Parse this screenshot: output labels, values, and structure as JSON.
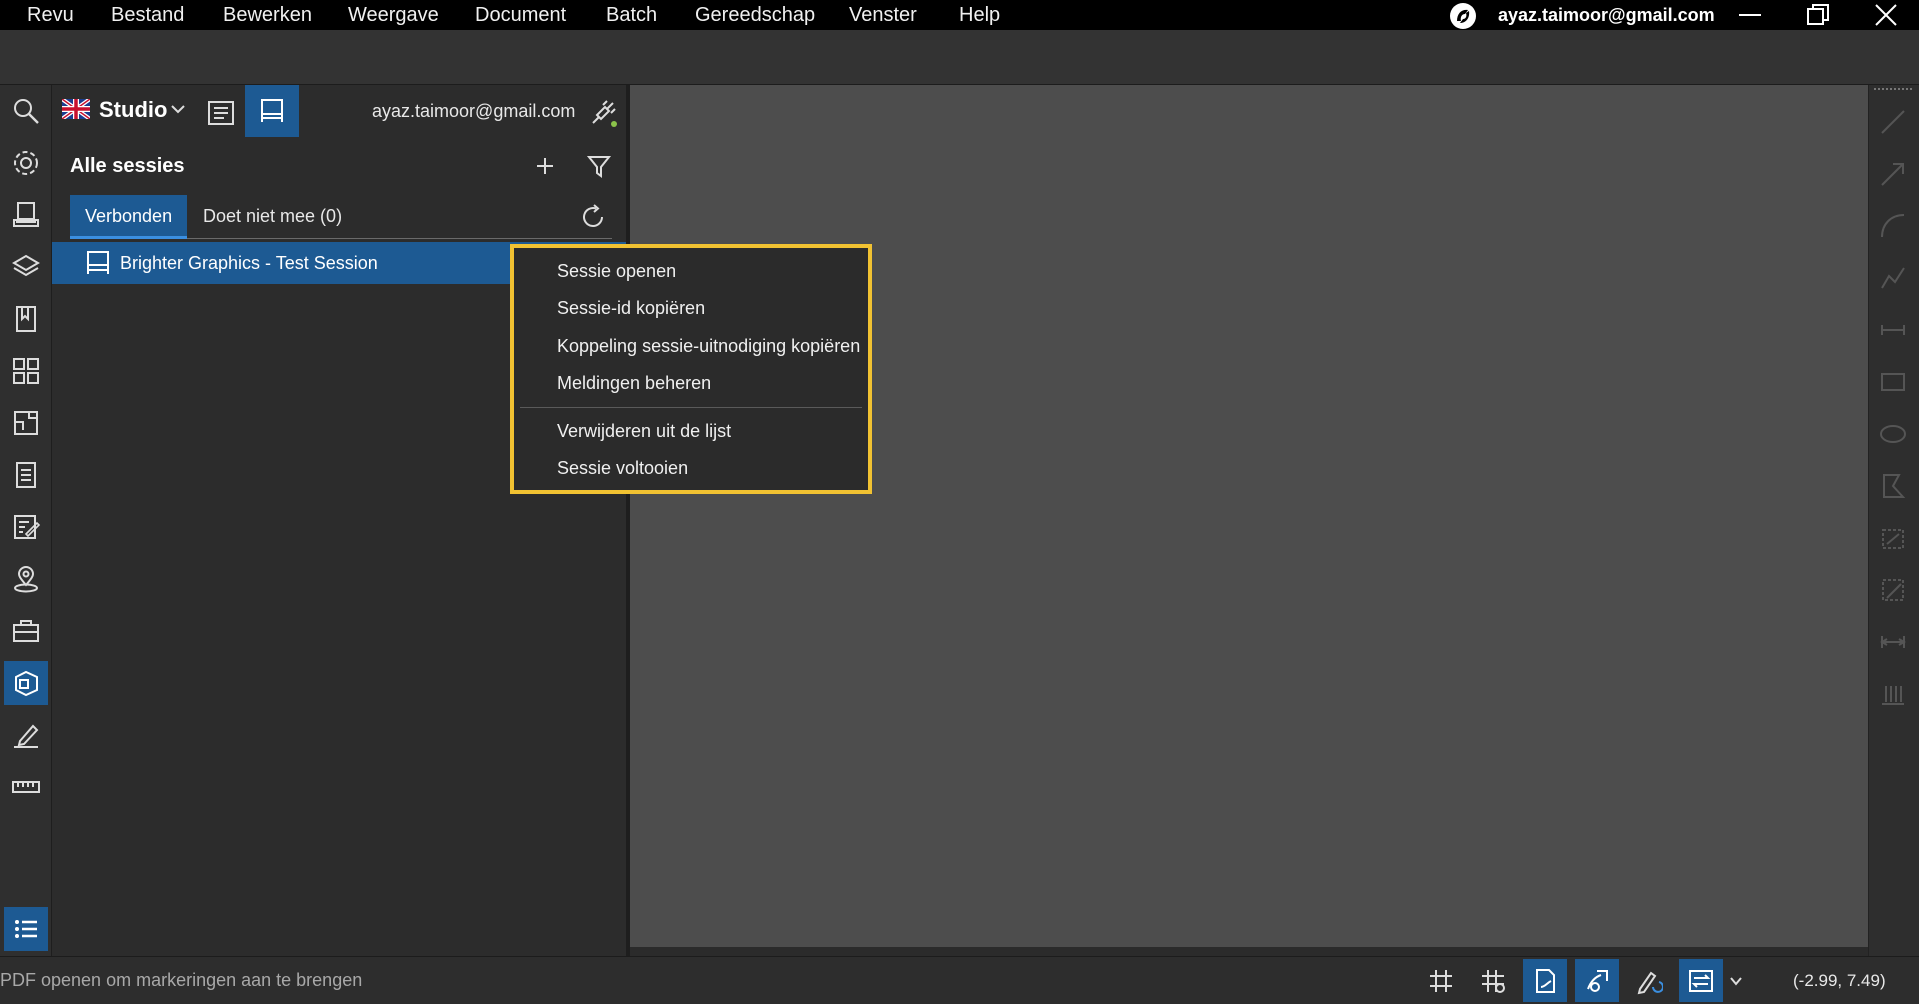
{
  "menubar": {
    "items": [
      "Revu",
      "Bestand",
      "Bewerken",
      "Weergave",
      "Document",
      "Batch",
      "Gereedschap",
      "Venster",
      "Help"
    ],
    "account_email": "ayaz.taimoor@gmail.com"
  },
  "studio": {
    "label": "Studio",
    "user_email": "ayaz.taimoor@gmail.com",
    "sessions_title": "Alle sessies",
    "tabs": [
      {
        "label": "Verbonden",
        "active": true
      },
      {
        "label": "Doet niet mee (0)",
        "active": false
      }
    ],
    "sessions": [
      {
        "label": "Brighter Graphics - Test Session",
        "selected": true
      }
    ]
  },
  "context_menu": {
    "items": [
      "Sessie openen",
      "Sessie-id kopiëren",
      "Koppeling sessie-uitnodiging kopiëren",
      "Meldingen beheren",
      "Verwijderen uit de lijst",
      "Sessie voltooien"
    ],
    "highlight_color": "#f1c232"
  },
  "statusbar": {
    "message": "PDF openen om markeringen aan te brengen",
    "coordinates": "(-2.99, 7.49)"
  },
  "theme": {
    "accent": "#1d5a93",
    "background": "#2b2b2b",
    "document_area": "#4d4d4d"
  }
}
